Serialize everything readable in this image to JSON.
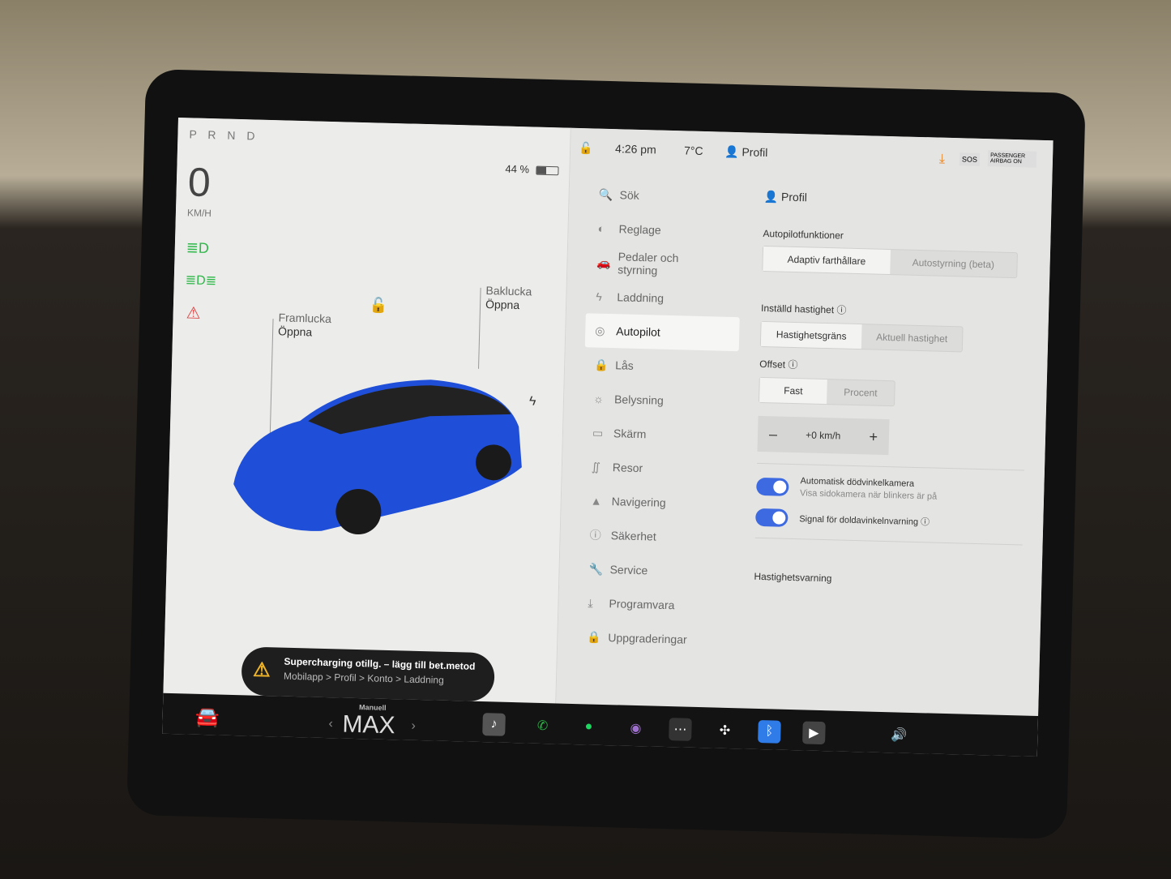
{
  "drive": {
    "gear": "P R N D",
    "speed": "0",
    "unit": "KM/H"
  },
  "car": {
    "frunk_label": "Framlucka",
    "frunk_action": "Öppna",
    "trunk_label": "Baklucka",
    "trunk_action": "Öppna",
    "color": "#1f4fd8"
  },
  "status": {
    "battery": "44 %",
    "time": "4:26 pm",
    "temp": "7°C",
    "profile": "Profil",
    "sos": "SOS",
    "airbag": "PASSENGER AIRBAG ON"
  },
  "alert": {
    "title": "Supercharging otillg. – lägg till bet.metod",
    "path": "Mobilapp > Profil > Konto > Laddning"
  },
  "menu": [
    {
      "label": "Sök",
      "icon": "🔍"
    },
    {
      "label": "Reglage",
      "icon": "◐"
    },
    {
      "label": "Pedaler och styrning",
      "icon": "🚗"
    },
    {
      "label": "Laddning",
      "icon": "ϟ"
    },
    {
      "label": "Autopilot",
      "icon": "◎"
    },
    {
      "label": "Lås",
      "icon": "🔒"
    },
    {
      "label": "Belysning",
      "icon": "☼"
    },
    {
      "label": "Skärm",
      "icon": "▭"
    },
    {
      "label": "Resor",
      "icon": "∬"
    },
    {
      "label": "Navigering",
      "icon": "▲"
    },
    {
      "label": "Säkerhet",
      "icon": "ⓘ"
    },
    {
      "label": "Service",
      "icon": "🔧"
    },
    {
      "label": "Programvara",
      "icon": "⤓"
    },
    {
      "label": "Uppgraderingar",
      "icon": "🔒"
    }
  ],
  "pane": {
    "profile": "Profil",
    "autopilot_heading": "Autopilotfunktioner",
    "autopilot_options": [
      "Adaptiv farthållare",
      "Autostyrning (beta)"
    ],
    "speed_heading": "Inställd hastighet",
    "speed_options": [
      "Hastighetsgräns",
      "Aktuell hastighet"
    ],
    "offset_heading": "Offset",
    "offset_options": [
      "Fast",
      "Procent"
    ],
    "offset_value": "+0 km/h",
    "minus": "–",
    "plus": "+",
    "toggle1_title": "Automatisk dödvinkelkamera",
    "toggle1_sub": "Visa sidokamera när blinkers är på",
    "toggle2_title": "Signal för doldavinkelnvarning",
    "next_heading": "Hastighetsvarning"
  },
  "dock": {
    "climate_mode": "Manuell",
    "fan": "MAX"
  },
  "accent": "#3e6ae1"
}
